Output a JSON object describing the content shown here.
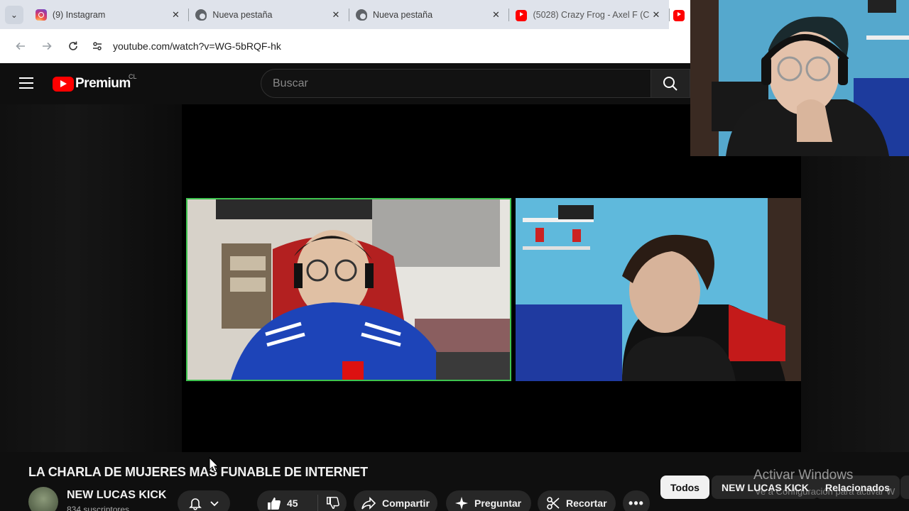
{
  "browser": {
    "tabs": [
      {
        "label": "(9) Instagram",
        "favicon": "instagram-icon"
      },
      {
        "label": "Nueva pestaña",
        "favicon": "chrome-icon"
      },
      {
        "label": "Nueva pestaña",
        "favicon": "chrome-icon"
      },
      {
        "label": "(5028) Crazy Frog - Axel F (C",
        "favicon": "youtube-icon"
      }
    ],
    "url": "youtube.com/watch?v=WG-5bRQF-hk"
  },
  "youtube": {
    "logo_text": "Premium",
    "country_code": "CL",
    "search_placeholder": "Buscar",
    "video_title": "LA CHARLA DE MUJERES MAS FUNABLE DE INTERNET",
    "channel_name": "NEW LUCAS KICK",
    "subscribers": "834 suscriptores",
    "likes": "45",
    "share_label": "Compartir",
    "ask_label": "Preguntar",
    "clip_label": "Recortar",
    "chips": [
      "Todos",
      "NEW LUCAS KICK",
      "Relacionados"
    ]
  },
  "overlay": {
    "activation_title": "Activar Windows",
    "activation_sub": "Ve a Configuración para activar W"
  },
  "colors": {
    "accent_red": "#ff0000",
    "speaking_border": "#3ec34f"
  }
}
